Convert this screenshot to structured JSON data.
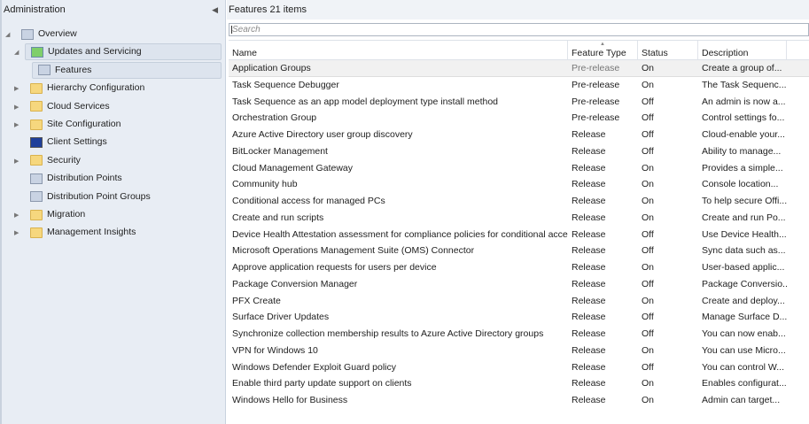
{
  "nav": {
    "title": "Administration",
    "collapse_icon": "chevron-left-icon",
    "items": [
      {
        "label": "Overview",
        "icon": "overview-icon",
        "expanded": true,
        "level": 0
      },
      {
        "label": "Updates and Servicing",
        "icon": "updates-icon",
        "expanded": true,
        "level": 1
      },
      {
        "label": "Features",
        "icon": "features-icon",
        "selected": true,
        "level": 2
      },
      {
        "label": "Hierarchy Configuration",
        "icon": "folder-icon",
        "expandable": true,
        "level": 1
      },
      {
        "label": "Cloud Services",
        "icon": "folder-icon",
        "expandable": true,
        "level": 1
      },
      {
        "label": "Site Configuration",
        "icon": "folder-icon",
        "expandable": true,
        "level": 1
      },
      {
        "label": "Client Settings",
        "icon": "monitor-icon",
        "level": 1
      },
      {
        "label": "Security",
        "icon": "folder-icon",
        "expandable": true,
        "level": 1
      },
      {
        "label": "Distribution Points",
        "icon": "distribution-point-icon",
        "level": 1
      },
      {
        "label": "Distribution Point Groups",
        "icon": "distribution-point-group-icon",
        "level": 1
      },
      {
        "label": "Migration",
        "icon": "folder-icon",
        "expandable": true,
        "level": 1
      },
      {
        "label": "Management Insights",
        "icon": "folder-icon",
        "expandable": true,
        "level": 1
      }
    ]
  },
  "main": {
    "title": "Features 21 items",
    "search_placeholder": "Search",
    "columns": [
      "Name",
      "Feature Type",
      "Status",
      "Description"
    ],
    "sorted_column": "Feature Type",
    "rows": [
      [
        "Application Groups",
        "Pre-release",
        "On",
        "Create a group of..."
      ],
      [
        "Task Sequence Debugger",
        "Pre-release",
        "On",
        "The Task Sequenc..."
      ],
      [
        "Task Sequence as an app model deployment type install method",
        "Pre-release",
        "Off",
        "An admin is now a..."
      ],
      [
        "Orchestration Group",
        "Pre-release",
        "Off",
        "Control settings fo..."
      ],
      [
        "Azure Active Directory user group discovery",
        "Release",
        "Off",
        "Cloud-enable your..."
      ],
      [
        "BitLocker Management",
        "Release",
        "Off",
        "Ability to manage..."
      ],
      [
        "Cloud Management Gateway",
        "Release",
        "On",
        "Provides a simple..."
      ],
      [
        "Community hub",
        "Release",
        "On",
        "Console location..."
      ],
      [
        "Conditional access for managed PCs",
        "Release",
        "On",
        "To help secure Offi..."
      ],
      [
        "Create and run scripts",
        "Release",
        "On",
        "Create and run Po..."
      ],
      [
        "Device Health Attestation assessment for compliance policies for conditional access",
        "Release",
        "Off",
        "Use Device Health..."
      ],
      [
        "Microsoft Operations Management Suite (OMS) Connector",
        "Release",
        "Off",
        "Sync data such as..."
      ],
      [
        "Approve application requests for users per device",
        "Release",
        "On",
        "User-based applic..."
      ],
      [
        "Package Conversion Manager",
        "Release",
        "Off",
        "Package Conversio..."
      ],
      [
        "PFX Create",
        "Release",
        "On",
        "Create and deploy..."
      ],
      [
        "Surface Driver Updates",
        "Release",
        "Off",
        "Manage Surface D..."
      ],
      [
        "Synchronize collection membership results to Azure Active Directory groups",
        "Release",
        "Off",
        "You can now enab..."
      ],
      [
        "VPN for Windows 10",
        "Release",
        "On",
        "You can use Micro..."
      ],
      [
        "Windows Defender Exploit Guard policy",
        "Release",
        "Off",
        "You can control W..."
      ],
      [
        "Enable third party update support on clients",
        "Release",
        "On",
        "Enables configurat..."
      ],
      [
        "Windows Hello for Business",
        "Release",
        "On",
        "Admin can target..."
      ]
    ],
    "selected_row": 0
  }
}
